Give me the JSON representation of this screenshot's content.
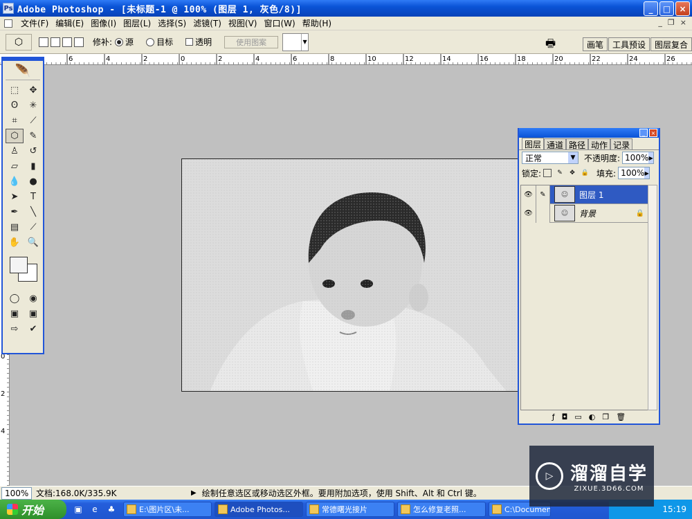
{
  "window": {
    "title": "Adobe Photoshop - [未标题-1 @ 100% (图层 1, 灰色/8)]"
  },
  "menubar": {
    "items": [
      "文件(F)",
      "编辑(E)",
      "图像(I)",
      "图层(L)",
      "选择(S)",
      "滤镜(T)",
      "视图(V)",
      "窗口(W)",
      "帮助(H)"
    ]
  },
  "options": {
    "patch_label": "修补:",
    "source_label": "源",
    "target_label": "目标",
    "transparent_label": "透明",
    "use_pattern_label": "使用图案"
  },
  "palette_well": {
    "tabs": [
      "画笔",
      "工具预设",
      "图层复合"
    ]
  },
  "ruler": {
    "h_ticks": [
      "6",
      "4",
      "2",
      "0",
      "2",
      "4",
      "6",
      "8",
      "10",
      "12",
      "14",
      "16",
      "18",
      "20",
      "22",
      "24",
      "26"
    ],
    "v_ticks": [
      "0",
      "2",
      "4"
    ]
  },
  "layers_panel": {
    "tabs": [
      "图层",
      "通道",
      "路径",
      "动作",
      "记录"
    ],
    "blend_mode": "正常",
    "opacity_label": "不透明度:",
    "opacity_value": "100%",
    "lock_label": "锁定:",
    "fill_label": "填充:",
    "fill_value": "100%",
    "layers": [
      {
        "name": "图层 1",
        "selected": true
      },
      {
        "name": "背景",
        "selected": false,
        "locked": true
      }
    ]
  },
  "status": {
    "zoom": "100%",
    "doc": "文档:168.0K/335.9K",
    "hint": "绘制任意选区或移动选区外框。要用附加选项，使用 Shift、Alt 和 Ctrl 键。"
  },
  "taskbar": {
    "start": "开始",
    "tasks": [
      "E:\\图片区\\未...",
      "Adobe Photos...",
      "常德曙光接片",
      "怎么修复老照...",
      "C:\\Documents..."
    ],
    "clock": "15:19"
  },
  "watermark": {
    "name": "溜溜自学",
    "url": "ZIXUE.3D66.COM"
  },
  "colors": {
    "title_bar": "#0a53d6",
    "chrome": "#ece9d8",
    "workspace": "#c0c0c0",
    "selected_layer": "#2f5ac2"
  }
}
